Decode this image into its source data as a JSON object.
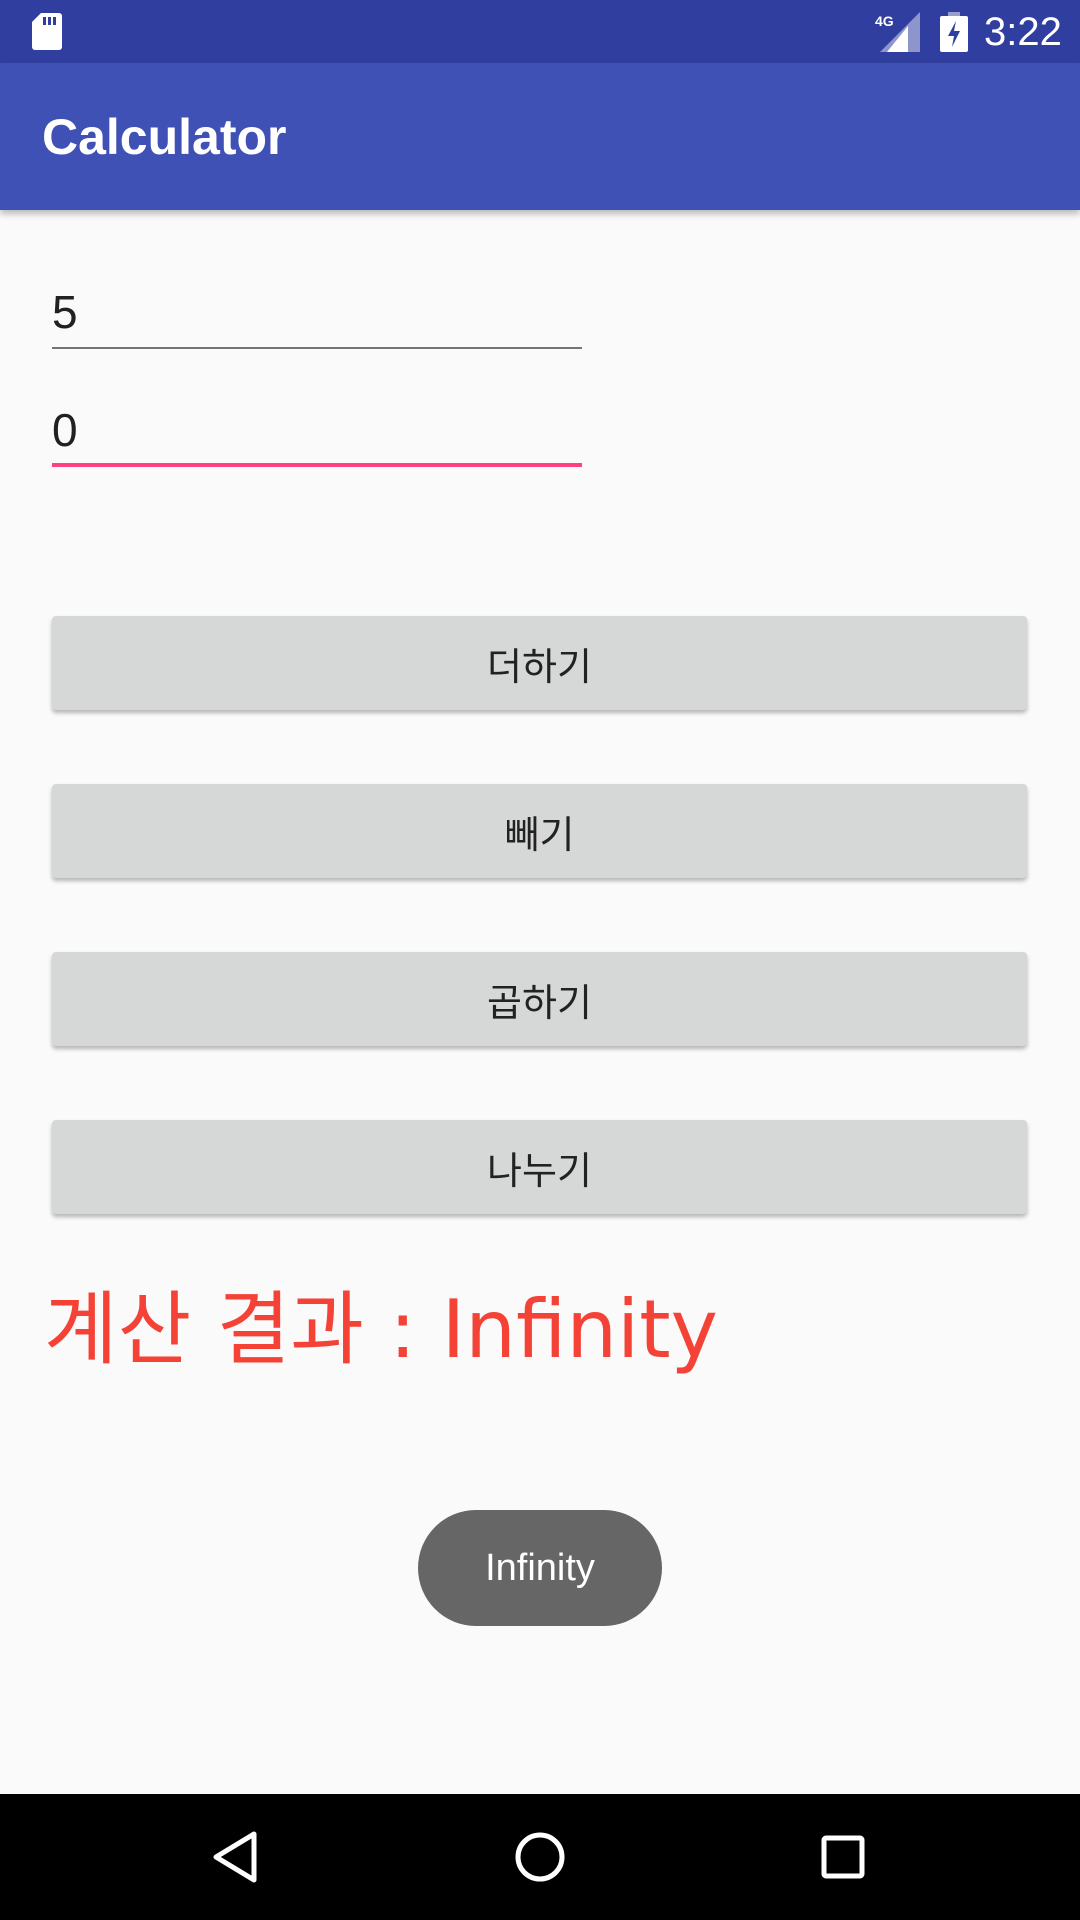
{
  "status_bar": {
    "time": "3:22",
    "network": "4G",
    "icons": [
      "sd-card-icon",
      "signal-4g-icon",
      "battery-charging-icon"
    ]
  },
  "app_bar": {
    "title": "Calculator"
  },
  "inputs": {
    "first_value": "5",
    "second_value": "0"
  },
  "buttons": {
    "add": "더하기",
    "subtract": "빼기",
    "multiply": "곱하기",
    "divide": "나누기"
  },
  "result": {
    "text": "계산 결과 : Infinity"
  },
  "toast": {
    "text": "Infinity"
  },
  "colors": {
    "status_bar": "#303f9f",
    "app_bar": "#3f51b5",
    "accent": "#ff4081",
    "result_text": "#f44336",
    "button_bg": "#d6d7d7",
    "toast_bg": "#666666"
  },
  "nav_bar": {
    "icons": [
      "back-icon",
      "home-icon",
      "recent-apps-icon"
    ]
  }
}
